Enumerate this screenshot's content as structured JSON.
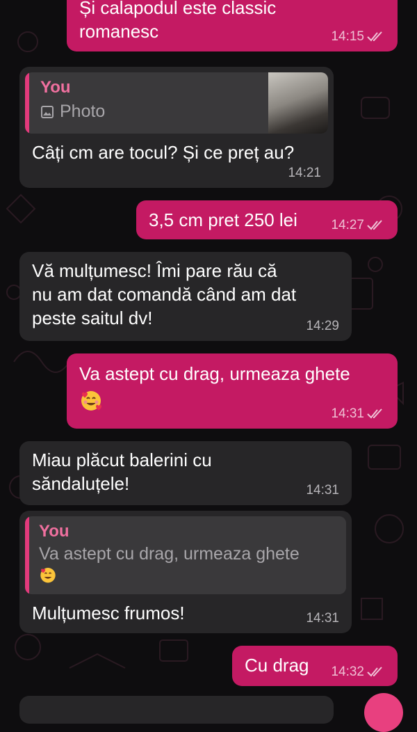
{
  "theme": {
    "outgoing_bubble": "#c41a63",
    "incoming_bubble": "#272628",
    "quote_accent": "#e23a7c",
    "background": "#0e0d0f"
  },
  "messages": [
    {
      "direction": "out",
      "text": "Și calapodul este classic\nromanesc",
      "time": "14:15",
      "status": "read"
    },
    {
      "direction": "in",
      "reply": {
        "author": "You",
        "label": "Photo",
        "icon": "image-icon"
      },
      "text": "Câți cm are tocul? Și ce preț au?",
      "time": "14:21"
    },
    {
      "direction": "out",
      "text": "3,5 cm pret 250 lei",
      "time": "14:27",
      "status": "read"
    },
    {
      "direction": "in",
      "text": "Vă mulțumesc! Îmi pare rău că\nnu am dat comandă când am dat\npeste saitul dv!",
      "time": "14:29"
    },
    {
      "direction": "out",
      "text": "Va astept cu drag, urmeaza ghete",
      "emoji": "smiling-face-with-hearts",
      "time": "14:31",
      "status": "read"
    },
    {
      "direction": "in",
      "text": "Miau plăcut balerini cu\nsăndaluțele!",
      "time": "14:31"
    },
    {
      "direction": "in",
      "reply": {
        "author": "You",
        "label": "Va astept cu drag, urmeaza ghete",
        "emoji": "smiling-face-with-hearts"
      },
      "text": "Mulțumesc frumos!",
      "time": "14:31"
    },
    {
      "direction": "out",
      "text": "Cu drag",
      "time": "14:32",
      "status": "read"
    }
  ]
}
